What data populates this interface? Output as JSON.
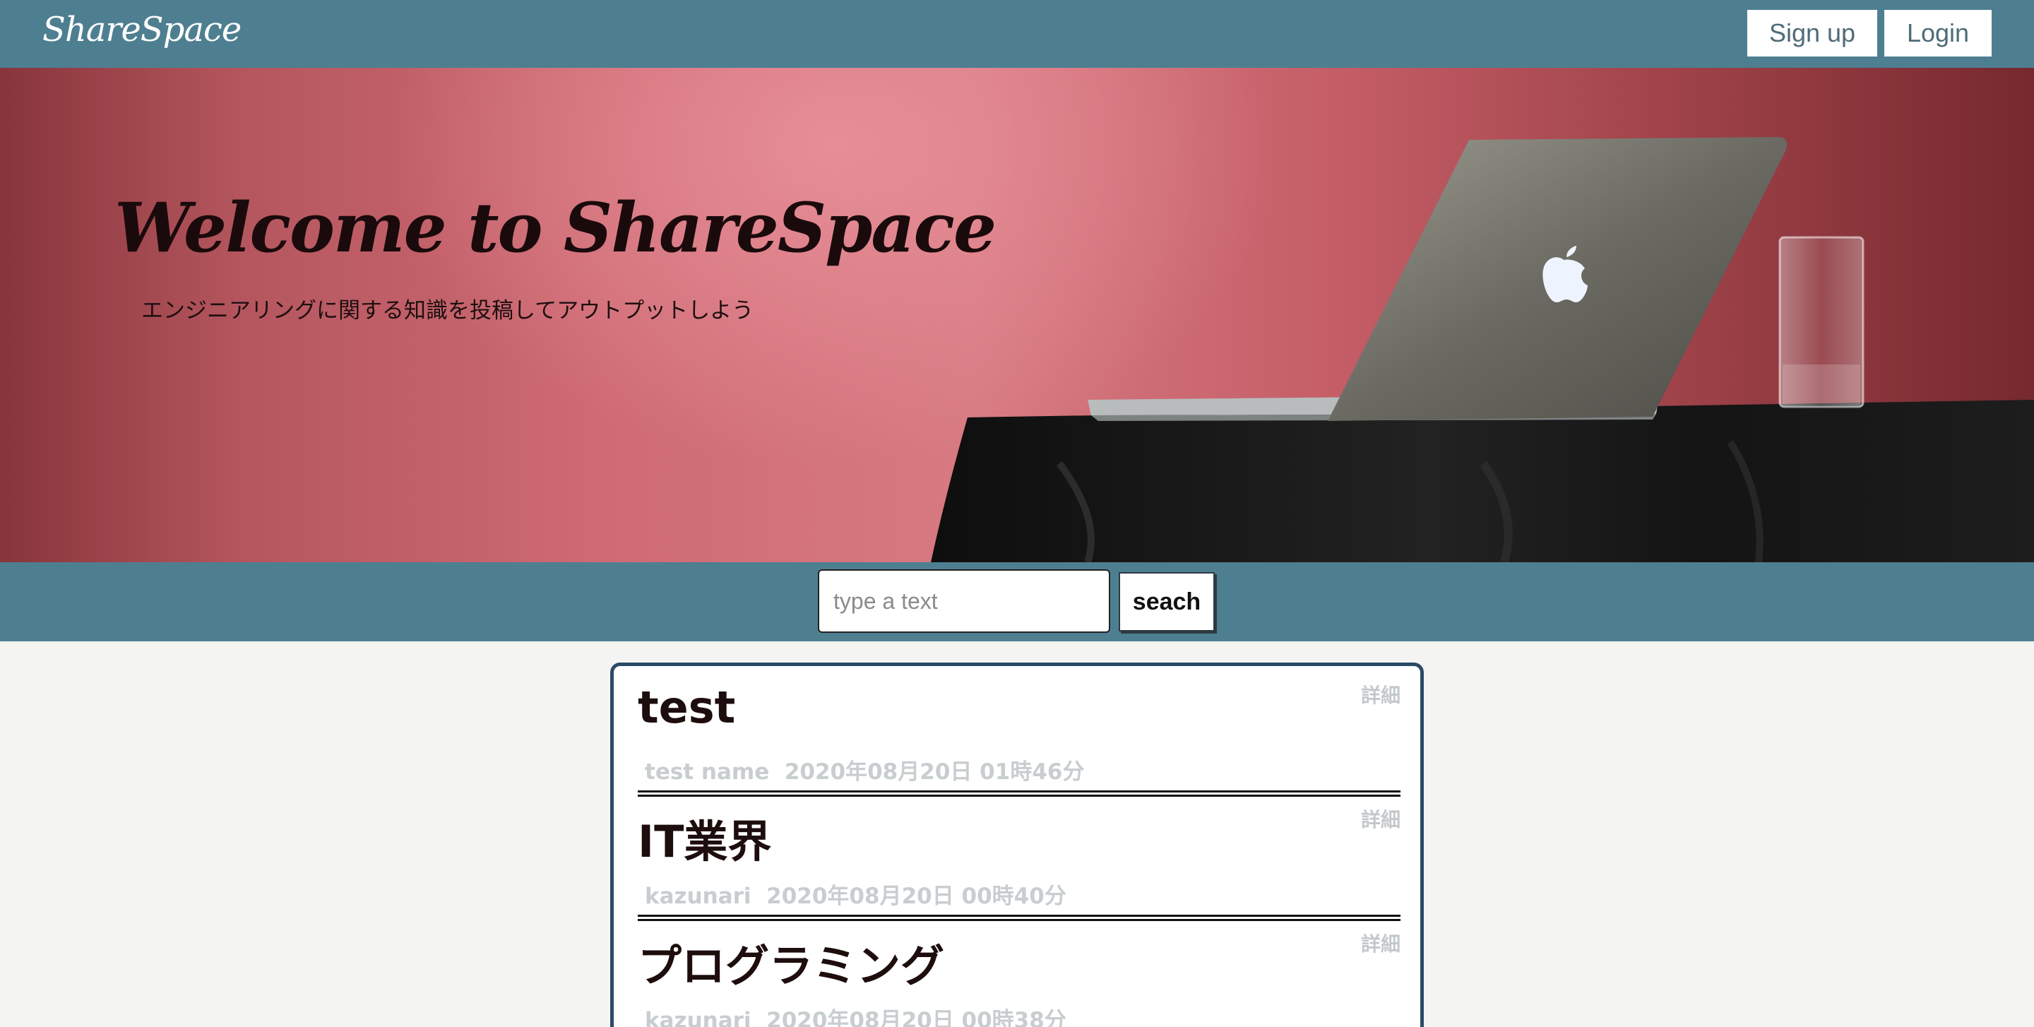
{
  "header": {
    "brand": "ShareSpace",
    "signup_label": "Sign up",
    "login_label": "Login"
  },
  "hero": {
    "title": "Welcome to ShareSpace",
    "subtitle": "エンジニアリングに関する知識を投稿してアウトプットしよう"
  },
  "search": {
    "placeholder": "type a text",
    "button_label": "seach"
  },
  "posts": [
    {
      "title": "test",
      "author": "test name",
      "date": "2020年08月20日 01時46分",
      "detail_label": "詳細"
    },
    {
      "title": "IT業界",
      "author": "kazunari",
      "date": "2020年08月20日 00時40分",
      "detail_label": "詳細"
    },
    {
      "title": "プログラミング",
      "author": "kazunari",
      "date": "2020年08月20日 00時38分",
      "detail_label": "詳細"
    }
  ],
  "colors": {
    "header_bg": "#4e7f91",
    "card_border": "#2b4a67",
    "page_bg": "#f4f4f2",
    "meta_text": "#c8cdd0"
  },
  "icons": [
    "apple-logo-icon"
  ]
}
